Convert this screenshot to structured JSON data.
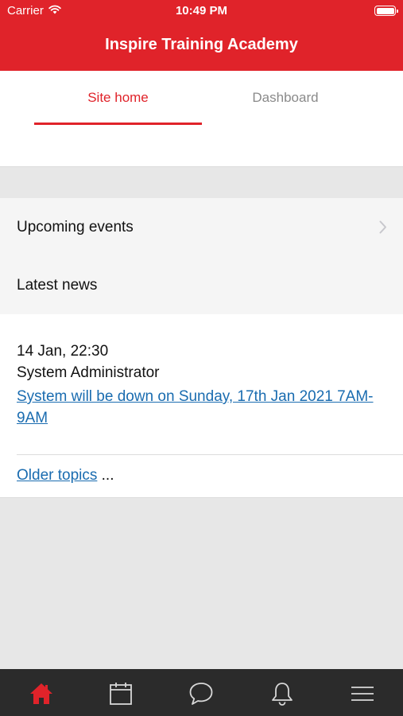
{
  "status_bar": {
    "carrier": "Carrier",
    "time": "10:49 PM"
  },
  "header": {
    "title": "Inspire Training Academy"
  },
  "tabs": [
    {
      "label": "Site home",
      "active": true
    },
    {
      "label": "Dashboard",
      "active": false
    }
  ],
  "sections": {
    "upcoming_events": "Upcoming events",
    "latest_news": "Latest news"
  },
  "news": {
    "date": "14 Jan, 22:30",
    "author": "System Administrator",
    "subject": "System will be down on Sunday, 17th Jan 2021 7AM-9AM",
    "older_link": "Older topics",
    "older_suffix": " ..."
  },
  "bottom_nav": {
    "items": [
      "home-icon",
      "calendar-icon",
      "messages-icon",
      "notifications-icon",
      "menu-icon"
    ],
    "active": "home-icon"
  },
  "colors": {
    "brand": "#e0232a",
    "link": "#1a6cb0",
    "tabbar": "#2b2b2b"
  }
}
